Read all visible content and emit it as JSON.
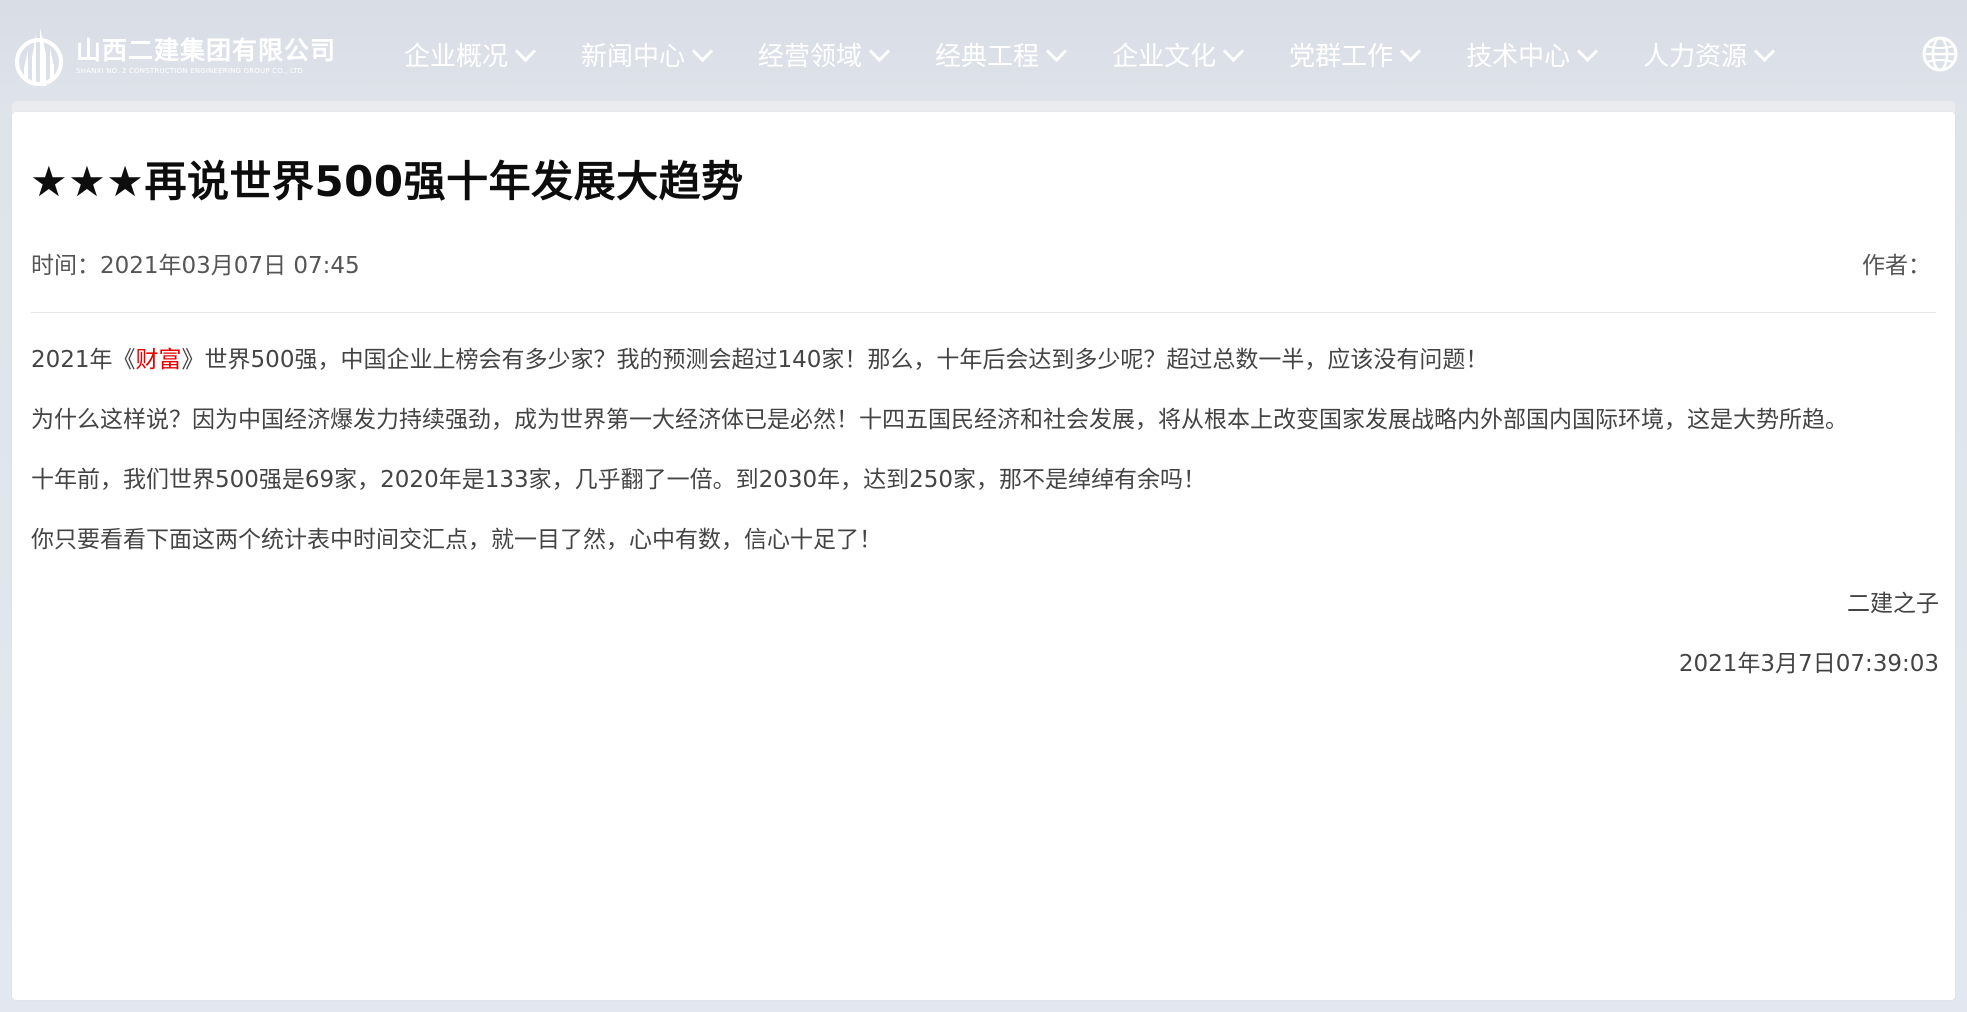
{
  "header": {
    "logo_cn": "山西二建集团有限公司",
    "logo_en": "SHANXI NO. 2 CONSTRUCTION ENGINEERING GROUP CO., LTD",
    "nav": [
      {
        "label": "企业概况"
      },
      {
        "label": "新闻中心"
      },
      {
        "label": "经营领域"
      },
      {
        "label": "经典工程"
      },
      {
        "label": "企业文化"
      },
      {
        "label": "党群工作"
      },
      {
        "label": "技术中心"
      },
      {
        "label": "人力资源"
      }
    ],
    "globe_icon": "globe-icon"
  },
  "article": {
    "title": "★★★再说世界500强十年发展大趋势",
    "time_label": "时间：2021年03月07日 07:45",
    "author_label": "作者：",
    "p1_before": "2021年《",
    "p1_highlight": "财富",
    "p1_after": "》世界500强，中国企业上榜会有多少家？我的预测会超过140家！那么，十年后会达到多少呢？超过总数一半，应该没有问题！",
    "p2": "为什么这样说？因为中国经济爆发力持续强劲，成为世界第一大经济体已是必然！十四五国民经济和社会发展，将从根本上改变国家发展战略内外部国内国际环境，这是大势所趋。",
    "p3": "十年前，我们世界500强是69家，2020年是133家，几乎翻了一倍。到2030年，达到250家，那不是绰绰有余吗！",
    "p4": "你只要看看下面这两个统计表中时间交汇点，就一目了然，心中有数，信心十足了！",
    "signature": "二建之子",
    "signature_date": "2021年3月7日07:39:03"
  },
  "colors": {
    "highlight": "#e60000",
    "header_text": "#ffffff",
    "body_text": "#444444"
  }
}
